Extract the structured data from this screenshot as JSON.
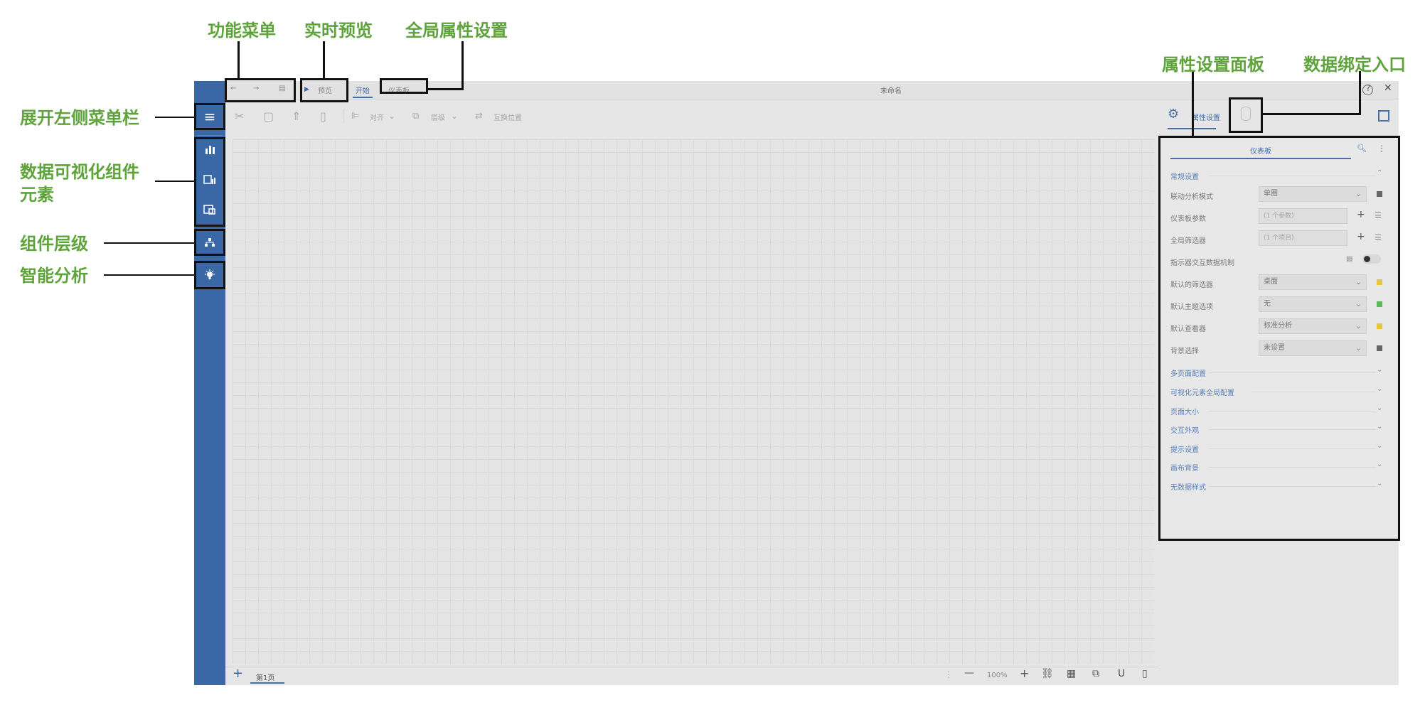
{
  "annotations": {
    "func_menu": "功能菜单",
    "live_preview": "实时预览",
    "global_settings": "全局属性设置",
    "prop_panel": "属性设置面板",
    "data_binding": "数据绑定入口",
    "expand_left": "展开左侧菜单栏",
    "viz_components_line1": "数据可视化组件",
    "viz_components_line2": "元素",
    "layer": "组件层级",
    "smart_analysis": "智能分析"
  },
  "titlebar": {
    "preview": "预览",
    "start_tab": "开始",
    "dashboard_tab": "仪表板",
    "title": "未命名"
  },
  "toolbar": {
    "align": "对齐",
    "layer_order": "层级",
    "swap": "互换位置"
  },
  "right_panel": {
    "tab_label": "属性设置",
    "sub_tab": "仪表板",
    "section_general": "常规设置",
    "rows": [
      {
        "label": "联动分析模式",
        "value": "单圈"
      },
      {
        "label": "仪表板参数",
        "value": "(1 个参数)"
      },
      {
        "label": "全局筛选器",
        "value": "(1 个项目)"
      },
      {
        "label": "指示器交互数据机制",
        "value": ""
      },
      {
        "label": "默认的筛选器",
        "value": "桌面"
      },
      {
        "label": "默认主题选项",
        "value": "无"
      },
      {
        "label": "默认查看器",
        "value": "标准分析"
      },
      {
        "label": "背景选择",
        "value": "未设置"
      }
    ],
    "sections": [
      "多页面配置",
      "可视化元素全局配置",
      "页面大小",
      "交互外观",
      "提示设置",
      "画布背景",
      "无数据样式"
    ]
  },
  "statusbar": {
    "page_tab": "第1页",
    "zoom": "100%"
  },
  "colors": {
    "sidebar": "#3a67a6",
    "annotation": "#5fa33c",
    "accent": "#4a6fa8"
  }
}
